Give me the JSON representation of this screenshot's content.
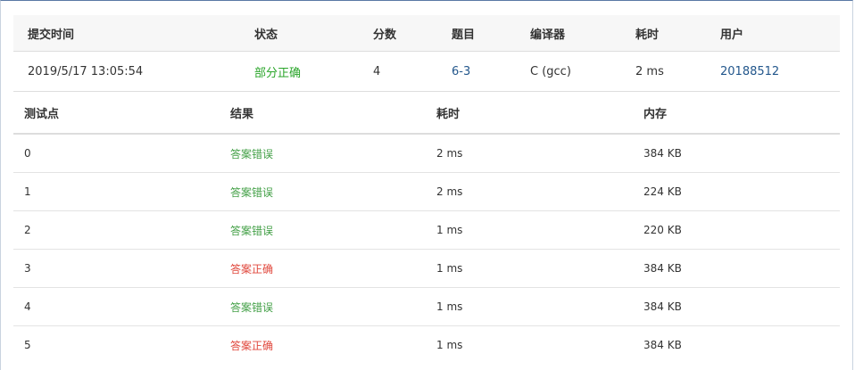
{
  "submission": {
    "headers": {
      "submit_time": "提交时间",
      "status": "状态",
      "score": "分数",
      "problem": "题目",
      "compiler": "编译器",
      "elapsed": "耗时",
      "user": "用户"
    },
    "row": {
      "submit_time": "2019/5/17 13:05:54",
      "status": "部分正确",
      "score": "4",
      "problem": "6-3",
      "compiler": "C (gcc)",
      "elapsed": "2 ms",
      "user": "20188512"
    }
  },
  "cases": {
    "headers": {
      "id": "测试点",
      "result": "结果",
      "time": "耗时",
      "memory": "内存"
    },
    "rows": [
      {
        "id": "0",
        "result": "答案错误",
        "time": "2 ms",
        "memory": "384 KB"
      },
      {
        "id": "1",
        "result": "答案错误",
        "time": "2 ms",
        "memory": "224 KB"
      },
      {
        "id": "2",
        "result": "答案错误",
        "time": "1 ms",
        "memory": "220 KB"
      },
      {
        "id": "3",
        "result": "答案正确",
        "time": "1 ms",
        "memory": "384 KB"
      },
      {
        "id": "4",
        "result": "答案错误",
        "time": "1 ms",
        "memory": "384 KB"
      },
      {
        "id": "5",
        "result": "答案正确",
        "time": "1 ms",
        "memory": "384 KB"
      }
    ]
  },
  "colors": {
    "partial_status": "#2aa52a",
    "wrong_answer": "#43a047",
    "correct_answer": "#e0473c",
    "link": "#23578c"
  }
}
